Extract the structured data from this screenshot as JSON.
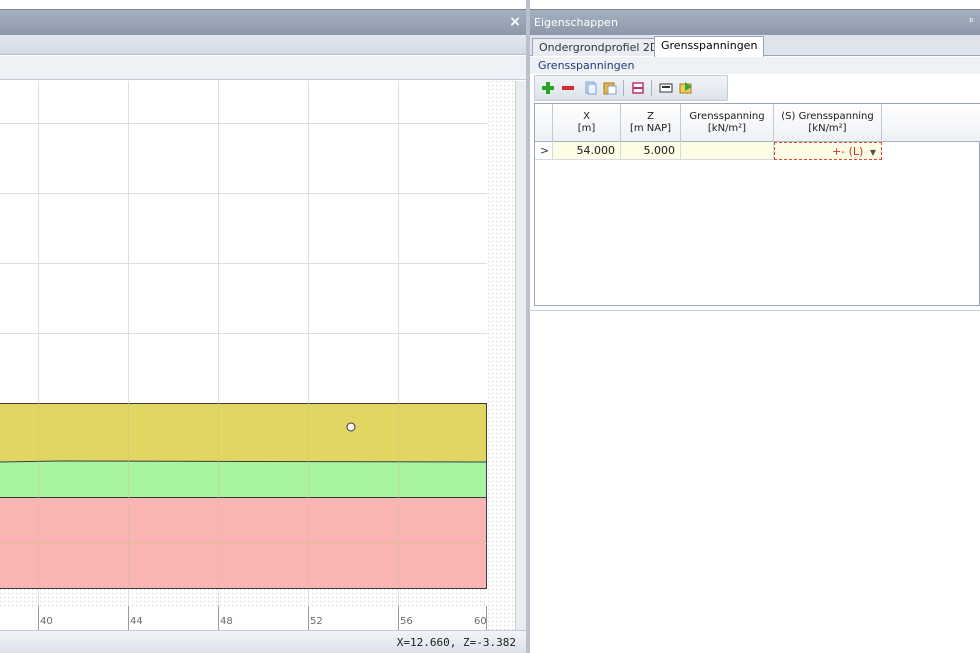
{
  "left_panel": {
    "close_glyph": "×",
    "coordinate_readout": "X=12.660, Z=-3.382",
    "x_axis_ticks": [
      "40",
      "44",
      "48",
      "52",
      "56",
      "60"
    ],
    "layers": [
      {
        "name": "layer-yellow",
        "color": "#e2d663"
      },
      {
        "name": "layer-green",
        "color": "#a8f5a1"
      },
      {
        "name": "layer-red",
        "color": "#f9b4b3"
      }
    ]
  },
  "properties": {
    "title": "Eigenschappen",
    "pin_glyph": "ᵖ",
    "tabs": [
      {
        "label": "Ondergrondprofiel 2D",
        "active": false
      },
      {
        "label": "Grensspanningen",
        "active": true
      }
    ],
    "section_label": "Grensspanningen",
    "toolbar_icons": [
      "add-icon",
      "remove-icon",
      "copy-icon",
      "paste-icon",
      "print-icon",
      "export-icon",
      "import-icon"
    ],
    "grid": {
      "columns": [
        {
          "line1": "X",
          "line2": "[m]"
        },
        {
          "line1": "Z",
          "line2": "[m NAP]"
        },
        {
          "line1": "Grensspanning",
          "line2": "[kN/m²]"
        },
        {
          "line1": "(S) Grensspanning",
          "line2": "[kN/m²]"
        }
      ],
      "rows": [
        {
          "indicator": ">",
          "x": "54.000",
          "z": "5.000",
          "grensspanning": "",
          "s_grensspanning": "+- (L)"
        }
      ]
    }
  },
  "colors": {
    "titlebar": "#97a2b3",
    "grid_line": "#dedede",
    "accent_red": "#c0392b"
  }
}
